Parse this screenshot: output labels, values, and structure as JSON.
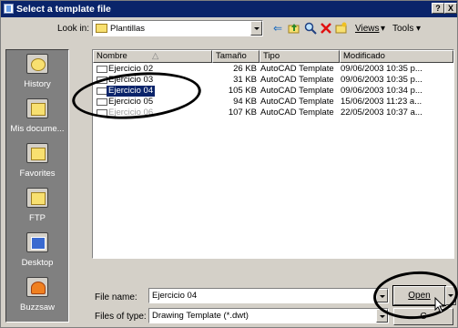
{
  "dialog": {
    "title": "Select a template file",
    "help_button": "?",
    "close_button": "X"
  },
  "toolbar": {
    "look_in_label": "Look in:",
    "look_in_value": "Plantillas",
    "views_label": "Views",
    "tools_label": "Tools"
  },
  "places": [
    {
      "label": "History"
    },
    {
      "label": "Mis docume..."
    },
    {
      "label": "Favorites"
    },
    {
      "label": "FTP"
    },
    {
      "label": "Desktop"
    },
    {
      "label": "Buzzsaw"
    }
  ],
  "columns": {
    "name": "Nombre",
    "size": "Tamaño",
    "type": "Tipo",
    "modified": "Modificado"
  },
  "files": [
    {
      "name": "Ejercicio 02",
      "size": "26 KB",
      "type": "AutoCAD Template",
      "modified": "09/06/2003 10:35 p..."
    },
    {
      "name": "Ejercicio 03",
      "size": "31 KB",
      "type": "AutoCAD Template",
      "modified": "09/06/2003 10:35 p..."
    },
    {
      "name": "Ejercicio 04",
      "size": "105 KB",
      "type": "AutoCAD Template",
      "modified": "09/06/2003 10:34 p..."
    },
    {
      "name": "Ejercicio 05",
      "size": "94 KB",
      "type": "AutoCAD Template",
      "modified": "15/06/2003 11:23 a..."
    },
    {
      "name": "Ejercicio 06",
      "size": "107 KB",
      "type": "AutoCAD Template",
      "modified": "22/05/2003 10:37 a..."
    }
  ],
  "selected_index": 2,
  "filename": {
    "label": "File name:",
    "value": "Ejercicio 04"
  },
  "filetype": {
    "label": "Files of type:",
    "value": "Drawing Template (*.dwt)"
  },
  "buttons": {
    "open": "Open",
    "cancel": "C"
  },
  "colors": {
    "titlebar": "#0a246a",
    "selection": "#0a246a",
    "window": "#d4d0c8",
    "places_bar": "#808080"
  }
}
